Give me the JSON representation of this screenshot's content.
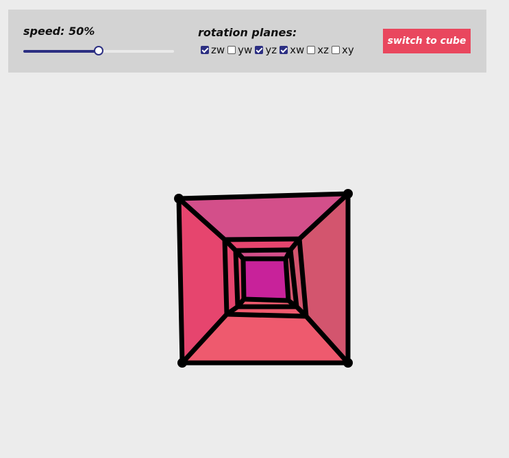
{
  "controls": {
    "speed_label": "speed: 50%",
    "speed_fraction": 0.5,
    "rotation_planes_label": "rotation planes:",
    "planes": [
      {
        "label": "zw",
        "checked": true
      },
      {
        "label": "yw",
        "checked": false
      },
      {
        "label": "yz",
        "checked": true
      },
      {
        "label": "xw",
        "checked": true
      },
      {
        "label": "xz",
        "checked": false
      },
      {
        "label": "xy",
        "checked": false
      }
    ],
    "switch_button": "switch to cube"
  },
  "colors": {
    "panel_bg": "#d3d3d3",
    "accent": "#2c2f82",
    "button": "#e9475e",
    "face_top": "#d34f8a",
    "face_left": "#e6456e",
    "face_right": "#d3556e",
    "face_bottom": "#ee5a6e",
    "inner_core": "#c8229a",
    "edge": "#000000"
  }
}
